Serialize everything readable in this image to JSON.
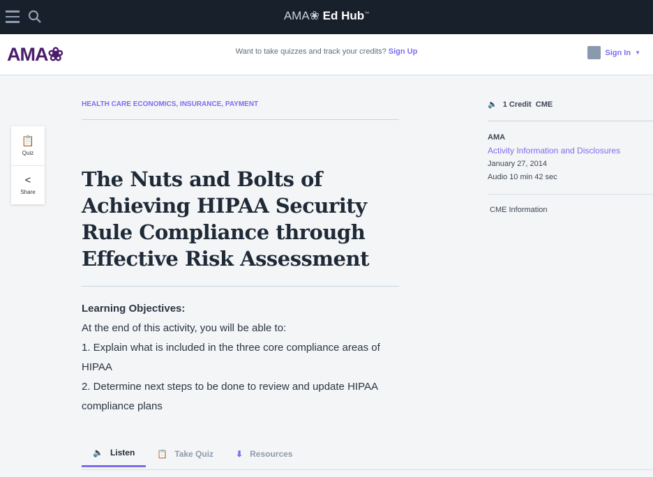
{
  "topbar": {
    "brand_ama": "AMA",
    "brand_edhub": "Ed Hub",
    "brand_tm": "™"
  },
  "header": {
    "logo": "AMA",
    "promo_text": "Want to take quizzes and track your credits?",
    "signup": "Sign Up",
    "signin": "Sign In"
  },
  "side_actions": [
    {
      "label": "Quiz"
    },
    {
      "label": "Share"
    }
  ],
  "article": {
    "category": "HEALTH CARE ECONOMICS, INSURANCE, PAYMENT",
    "title": "The Nuts and Bolts of Achieving HIPAA Security Rule Compliance through Effective Risk Assessment",
    "objectives_heading": "Learning Objectives:",
    "objectives_intro": "At the end of this activity, you will be able to:",
    "objectives": [
      "1. Explain what is included in the three core compliance areas of HIPAA",
      "2. Determine next steps to be done to review and update HIPAA compliance plans"
    ]
  },
  "tabs": [
    {
      "label": "Listen"
    },
    {
      "label": "Take Quiz"
    },
    {
      "label": "Resources"
    }
  ],
  "sidebar": {
    "credit": "1 Credit  CME",
    "org": "AMA",
    "link": "Activity Information and Disclosures",
    "date": "January 27, 2014",
    "duration": "Audio 10 min 42 sec",
    "cme_info": "CME Information"
  },
  "colors": {
    "accent": "#7b6cf0",
    "topbar": "#18202c",
    "logo": "#4b1d6b"
  }
}
